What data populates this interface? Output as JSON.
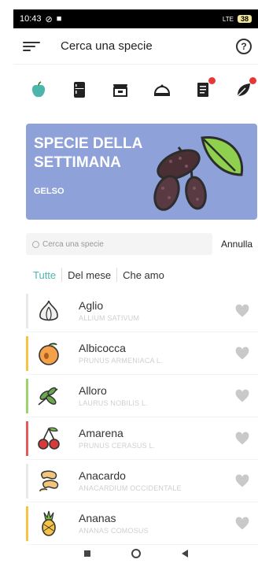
{
  "status": {
    "time": "10:43",
    "signal": "LTE",
    "battery": "38"
  },
  "appbar": {
    "title": "Cerca una specie"
  },
  "categories": [
    {
      "icon": "apple-icon",
      "active": true
    },
    {
      "icon": "fridge-icon"
    },
    {
      "icon": "shop-icon"
    },
    {
      "icon": "cloche-icon"
    },
    {
      "icon": "list-icon",
      "badge": true
    },
    {
      "icon": "leaf-icon",
      "badge": true
    }
  ],
  "banner": {
    "title": "SPECIE DELLA SETTIMANA",
    "subtitle": "GELSO",
    "color": "#8ea1d8"
  },
  "search": {
    "placeholder": "Cerca una specie",
    "cancel": "Annulla"
  },
  "filters": {
    "all": "Tutte",
    "month": "Del mese",
    "loved": "Che amo"
  },
  "species": [
    {
      "name": "Aglio",
      "latin": "ALLIUM SATIVUM",
      "bar": "#e9e9e9",
      "icon": "garlic-icon"
    },
    {
      "name": "Albicocca",
      "latin": "PRUNUS ARMENIACA L.",
      "bar": "#f6c344",
      "icon": "apricot-icon"
    },
    {
      "name": "Alloro",
      "latin": "LAURUS NOBILIS L.",
      "bar": "#9bd46b",
      "icon": "laurel-icon"
    },
    {
      "name": "Amarena",
      "latin": "PRUNUS CERASUS L.",
      "bar": "#e45a5a",
      "icon": "cherry-icon"
    },
    {
      "name": "Anacardo",
      "latin": "ANACARDIUM OCCIDENTALE",
      "bar": "#e9e9e9",
      "icon": "cashew-icon"
    },
    {
      "name": "Ananas",
      "latin": "ANANAS COMOSUS",
      "bar": "#f6c344",
      "icon": "pineapple-icon"
    }
  ]
}
